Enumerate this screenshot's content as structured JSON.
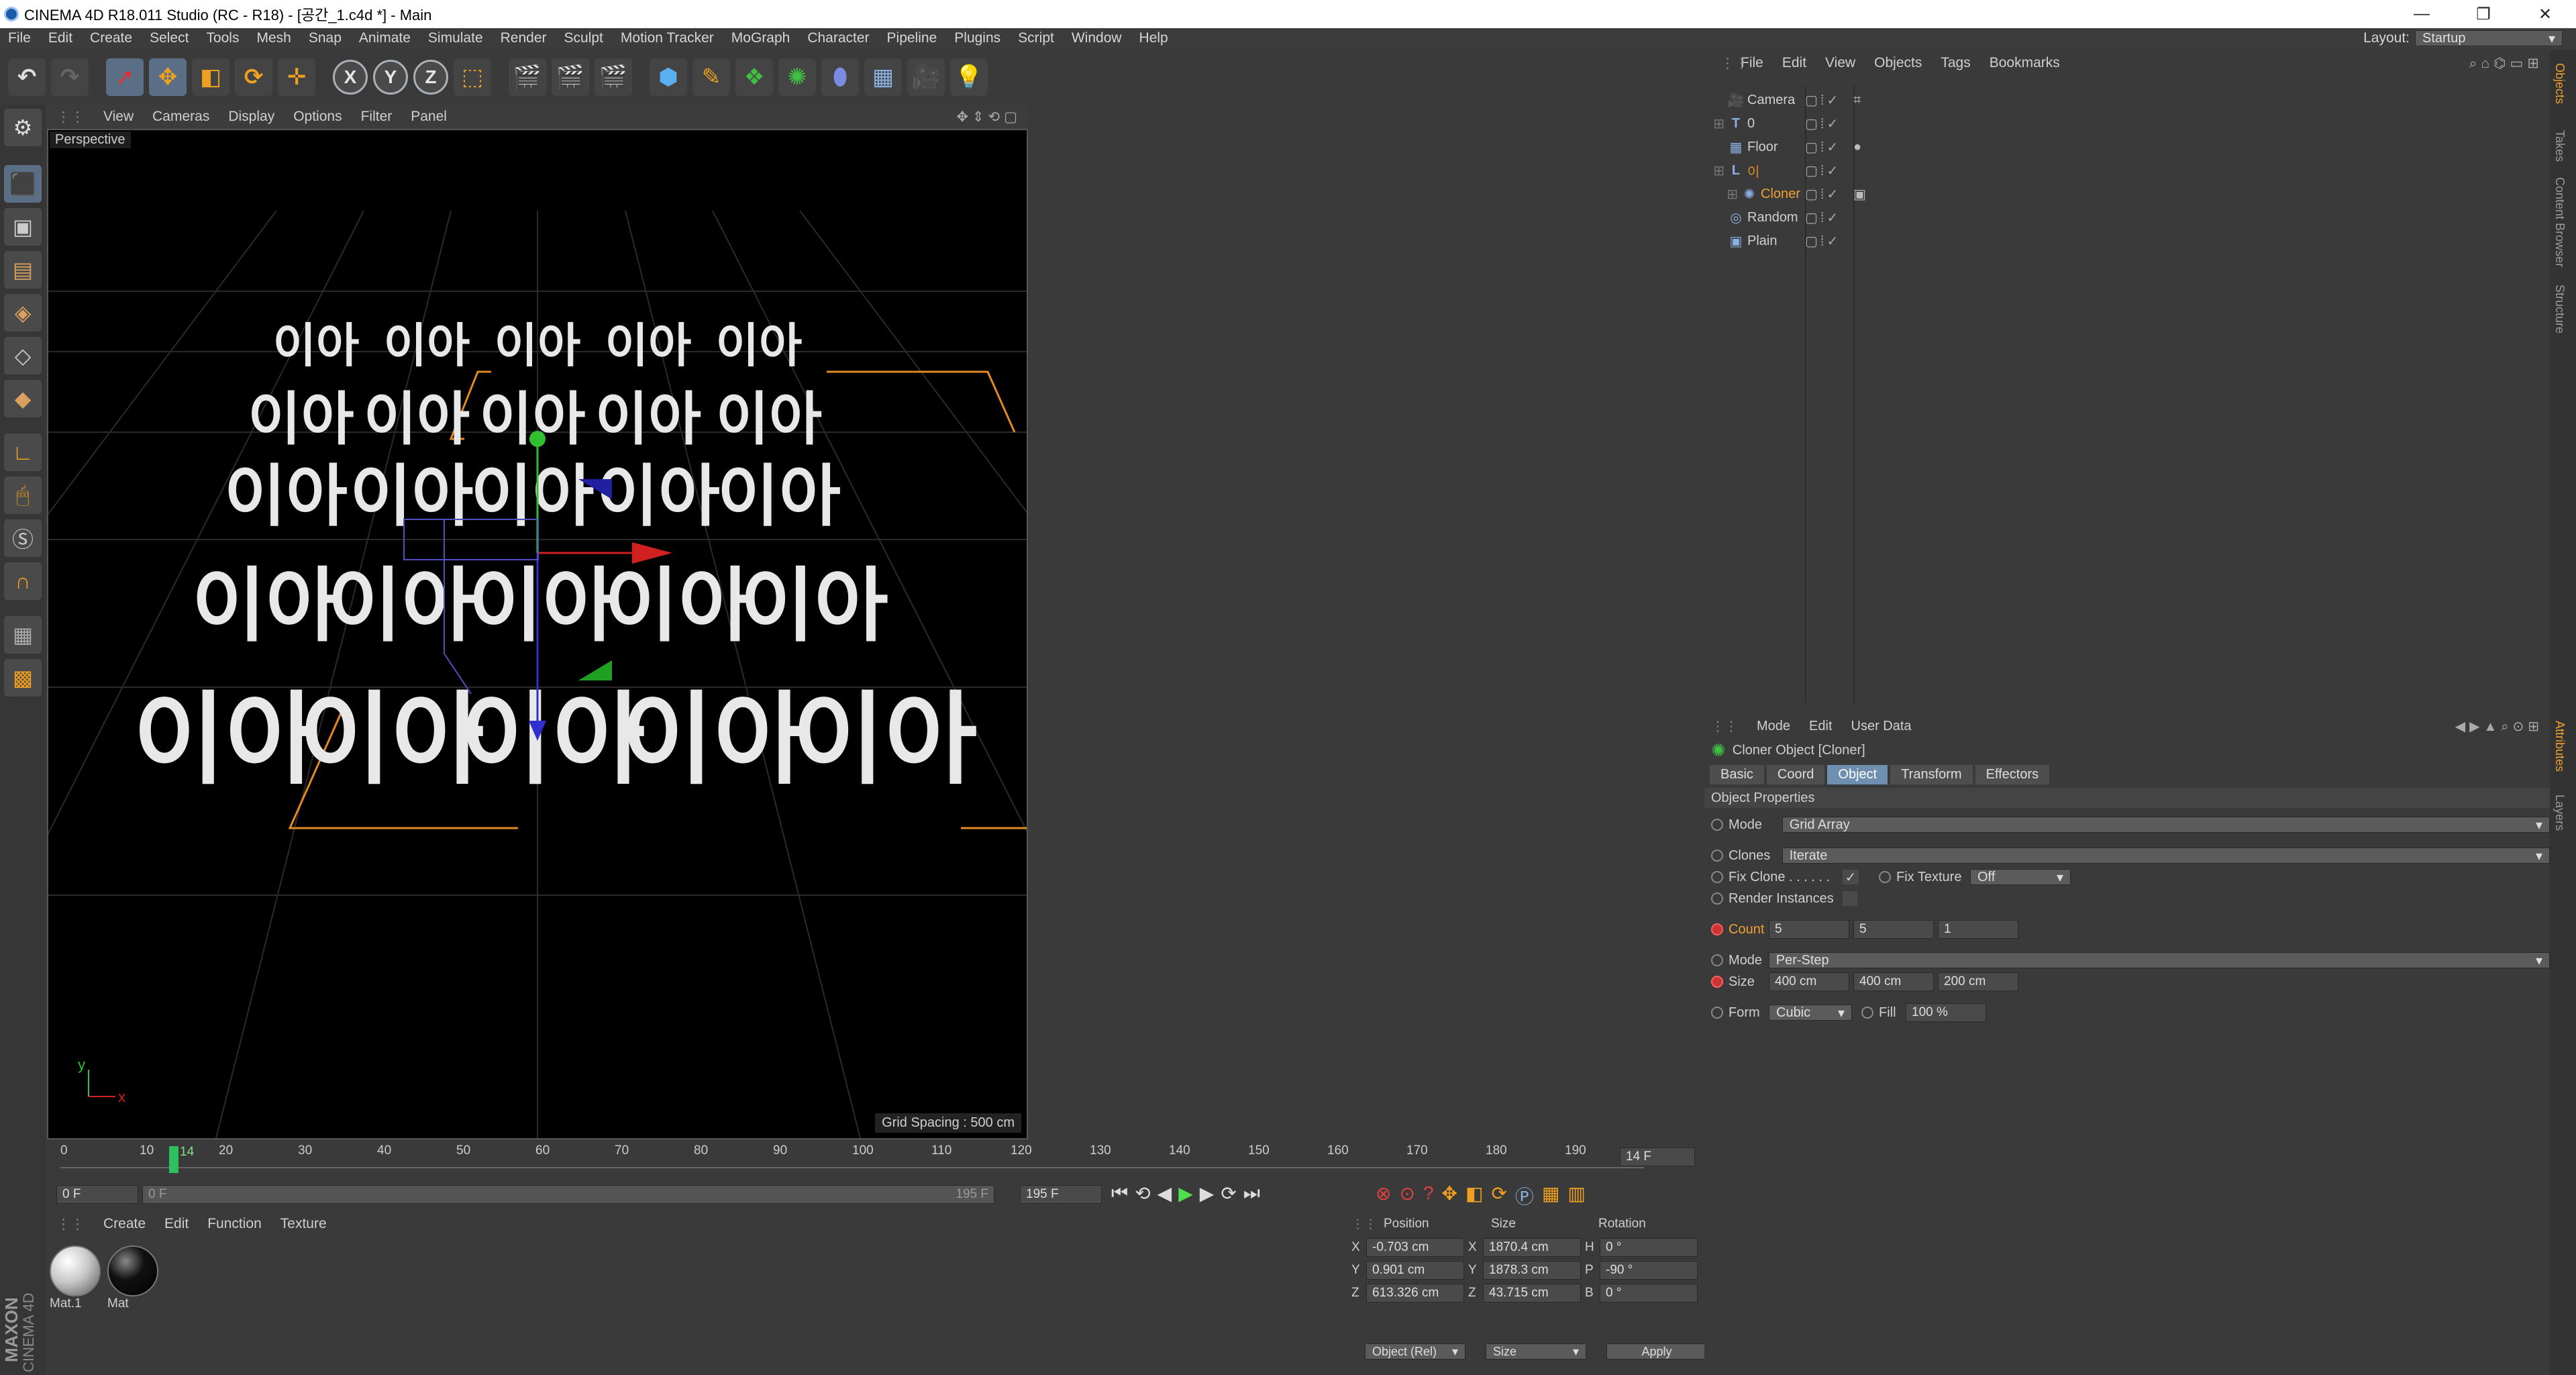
{
  "window": {
    "title": "CINEMA 4D R18.011 Studio (RC - R18) - [공간_1.c4d *] - Main",
    "controls": [
      "—",
      "❐",
      "✕"
    ]
  },
  "menubar": {
    "items": [
      "File",
      "Edit",
      "Create",
      "Select",
      "Tools",
      "Mesh",
      "Snap",
      "Animate",
      "Simulate",
      "Render",
      "Sculpt",
      "Motion Tracker",
      "MoGraph",
      "Character",
      "Pipeline",
      "Plugins",
      "Script",
      "Window",
      "Help"
    ],
    "layout_label": "Layout:",
    "layout_value": "Startup"
  },
  "toolbar": {
    "axis_x": "X",
    "axis_y": "Y",
    "axis_z": "Z"
  },
  "viewport": {
    "menu": [
      "View",
      "Cameras",
      "Display",
      "Options",
      "Filter",
      "Panel"
    ],
    "label": "Perspective",
    "grid_spacing": "Grid Spacing : 500 cm",
    "clone_text": "이아",
    "axis_y": "y",
    "axis_x": "x"
  },
  "timeline": {
    "ticks": [
      "0",
      "10",
      "20",
      "30",
      "40",
      "50",
      "60",
      "70",
      "80",
      "90",
      "100",
      "110",
      "120",
      "130",
      "140",
      "150",
      "160",
      "170",
      "180",
      "190"
    ],
    "current_marker": "14",
    "current_frame": "14 F",
    "start": "0 F",
    "range_start": "0 F",
    "range_end": "195 F",
    "end": "195 F"
  },
  "material_manager": {
    "menu": [
      "Create",
      "Edit",
      "Function",
      "Texture"
    ],
    "materials": [
      {
        "name": "Mat.1",
        "color": "#d8d8d8"
      },
      {
        "name": "Mat",
        "color": "#111111"
      }
    ]
  },
  "coordinates": {
    "headers": [
      "Position",
      "Size",
      "Rotation"
    ],
    "rows": [
      {
        "axis": "X",
        "pos": "-0.703 cm",
        "size_axis": "X",
        "size": "1870.4 cm",
        "rot_axis": "H",
        "rot": "0 °"
      },
      {
        "axis": "Y",
        "pos": "0.901 cm",
        "size_axis": "Y",
        "size": "1878.3 cm",
        "rot_axis": "P",
        "rot": "-90 °"
      },
      {
        "axis": "Z",
        "pos": "613.326 cm",
        "size_axis": "Z",
        "size": "43.715 cm",
        "rot_axis": "B",
        "rot": "0 °"
      }
    ],
    "mode": "Object (Rel)",
    "size_mode": "Size",
    "apply": "Apply"
  },
  "object_manager": {
    "menu": [
      "File",
      "Edit",
      "View",
      "Objects",
      "Tags",
      "Bookmarks"
    ],
    "objects": [
      {
        "name": "Camera",
        "color": "#cfcfcf"
      },
      {
        "name": "0",
        "color": "#cfcfcf"
      },
      {
        "name": "Floor",
        "color": "#cfcfcf"
      },
      {
        "name": "이",
        "color": "#e08a2a"
      },
      {
        "name": "Cloner",
        "color": "#f0a030"
      },
      {
        "name": "Random",
        "color": "#cfcfcf"
      },
      {
        "name": "Plain",
        "color": "#cfcfcf"
      }
    ]
  },
  "attribute_manager": {
    "menu": [
      "Mode",
      "Edit",
      "User Data"
    ],
    "title": "Cloner Object [Cloner]",
    "tabs": [
      "Basic",
      "Coord",
      "Object",
      "Transform",
      "Effectors"
    ],
    "active_tab": "Object",
    "section": "Object Properties",
    "mode_label": "Mode",
    "mode_value": "Grid Array",
    "clones_label": "Clones",
    "clones_value": "Iterate",
    "fix_clone_label": "Fix Clone . . . . . .",
    "fix_clone_check": "✓",
    "fix_texture_label": "Fix Texture",
    "fix_texture_value": "Off",
    "render_instances_label": "Render Instances",
    "count_label": "Count",
    "count": [
      "5",
      "5",
      "1"
    ],
    "mode2_label": "Mode",
    "mode2_value": "Per-Step",
    "size_label": "Size",
    "size": [
      "400 cm",
      "400 cm",
      "200 cm"
    ],
    "form_label": "Form",
    "form_value": "Cubic",
    "fill_label": "Fill",
    "fill_value": "100 %"
  },
  "right_strip": {
    "tabs_top": [
      "Objects",
      "Takes",
      "Content Browser",
      "Structure"
    ],
    "tabs_bottom": [
      "Attributes",
      "Layers"
    ]
  },
  "brand": {
    "maxon": "MAXON",
    "c4d": "CINEMA 4D"
  }
}
